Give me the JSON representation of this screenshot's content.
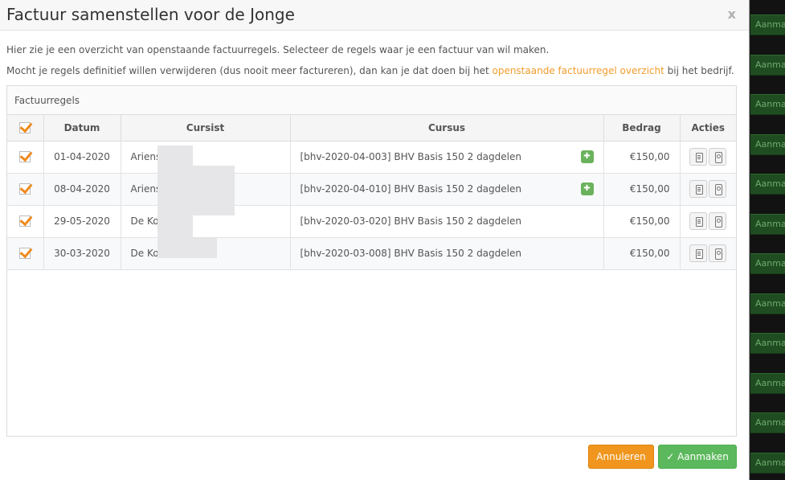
{
  "modal": {
    "title": "Factuur samenstellen voor de Jonge",
    "close_label": "x",
    "intro_line1": "Hier zie je een overzicht van openstaande factuurregels. Selecteer de regels waar je een factuur van wil maken.",
    "intro_line2_pre": "Mocht je regels definitief willen verwijderen (dus nooit meer factureren), dan kan je dat doen bij het ",
    "intro_line2_link": "openstaande factuurregel overzicht",
    "intro_line2_post": " bij het bedrijf.",
    "panel_title": "Factuurregels",
    "columns": {
      "datum": "Datum",
      "cursist": "Cursist",
      "cursus": "Cursus",
      "bedrag": "Bedrag",
      "acties": "Acties"
    },
    "rows": [
      {
        "date": "01-04-2020",
        "student": "Ariens",
        "course": "[bhv-2020-04-003] BHV Basis 150 2 dagdelen",
        "amount": "€150,00",
        "gift": true
      },
      {
        "date": "08-04-2020",
        "student": "Ariens",
        "course": "[bhv-2020-04-010] BHV Basis 150 2 dagdelen",
        "amount": "€150,00",
        "gift": true
      },
      {
        "date": "29-05-2020",
        "student": "De Ko",
        "course": "[bhv-2020-03-020] BHV Basis 150 2 dagdelen",
        "amount": "€150,00",
        "gift": false
      },
      {
        "date": "30-03-2020",
        "student": "De Ko",
        "course": "[bhv-2020-03-008] BHV Basis 150 2 dagdelen",
        "amount": "€150,00",
        "gift": false
      }
    ],
    "cancel_label": "Annuleren",
    "create_label": "Aanmaken",
    "create_icon": "✓"
  },
  "background": {
    "button_label": "Aanma",
    "colors": {
      "button_bg": "#1f4d21"
    }
  },
  "colors": {
    "accent_orange": "#f08a1c",
    "success_green": "#5cb85c",
    "link_orange": "#f39c2c"
  }
}
